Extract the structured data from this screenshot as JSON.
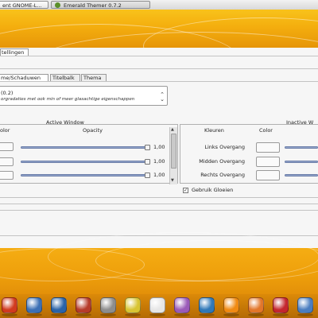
{
  "taskbar": {
    "tasks": [
      {
        "label": "ent GNOME-L..."
      },
      {
        "label": "Emerald Themer 0.7.2"
      }
    ]
  },
  "window": {
    "settings_tab": "tellingen",
    "subtabs": [
      {
        "label": "me/Schaduwen"
      },
      {
        "label": "Titelbalk"
      },
      {
        "label": "Thema"
      }
    ],
    "theme_select": {
      "title": "(0.2)",
      "description": "orgradaties met ook min of meer glasachtige eigenschappen"
    },
    "active": {
      "title": "Active Window",
      "col_color": "olor",
      "col_opacity": "Opacity",
      "rows": [
        {
          "value": "1,00",
          "opacity": 1.0
        },
        {
          "value": "1,00",
          "opacity": 1.0
        },
        {
          "value": "1,00",
          "opacity": 1.0
        }
      ]
    },
    "inactive": {
      "title": "Inactive W",
      "col_colors": "Kleuren",
      "col_color": "Color",
      "rows": [
        {
          "label": "Links Overgang"
        },
        {
          "label": "Midden Overgang"
        },
        {
          "label": "Rechts Overgang"
        }
      ]
    },
    "glow": {
      "label": "Gebruik Gloeien",
      "checked": true,
      "check_mark": "✓"
    }
  },
  "dock": {
    "icons": [
      {
        "name": "app",
        "color": "#d13a1f"
      },
      {
        "name": "browser",
        "color": "#3b6fb5"
      },
      {
        "name": "chat",
        "color": "#2a63a8"
      },
      {
        "name": "books",
        "color": "#b63b2a"
      },
      {
        "name": "disc",
        "color": "#8d8d8d"
      },
      {
        "name": "easytag",
        "color": "#d8c432"
      },
      {
        "name": "media",
        "color": "#e6e6e6"
      },
      {
        "name": "music",
        "color": "#9a5ab8"
      },
      {
        "name": "photos",
        "color": "#2f78b8"
      },
      {
        "name": "vlc",
        "color": "#f08a12"
      },
      {
        "name": "burn",
        "color": "#e2762a"
      },
      {
        "name": "miro",
        "color": "#c4262e"
      },
      {
        "name": "network",
        "color": "#4a7dc0"
      }
    ]
  }
}
